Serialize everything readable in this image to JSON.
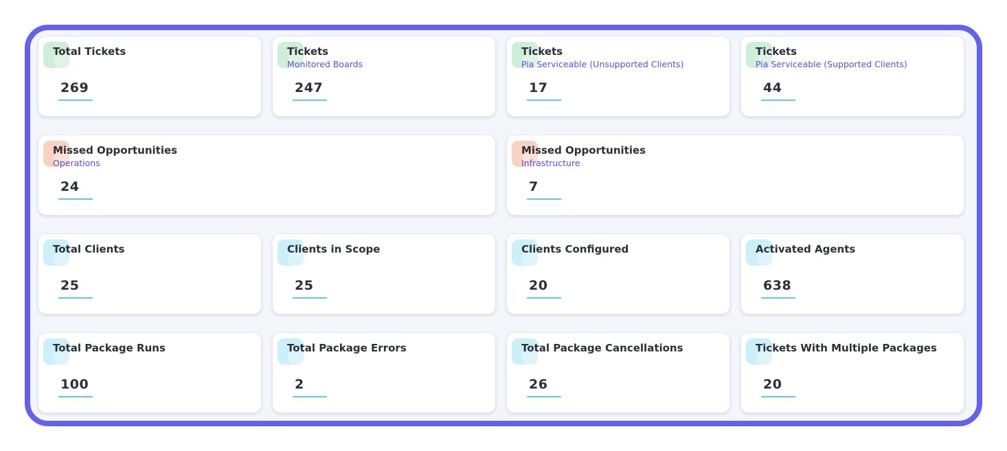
{
  "colors": {
    "frame_border": "#6361f0",
    "subtitle": "#5b4fe0",
    "underline": "#62c9ea",
    "icon_green": "#c6ead4",
    "icon_orange": "#f8cbb8",
    "icon_cyan": "#c4eef8"
  },
  "cards": [
    {
      "title": "Total Tickets",
      "subtitle": "",
      "value": "269",
      "icon": "ticket-icon",
      "icon_color": "green"
    },
    {
      "title": "Tickets",
      "subtitle": "Monitored Boards",
      "value": "247",
      "icon": "ticket-icon",
      "icon_color": "green"
    },
    {
      "title": "Tickets",
      "subtitle": "Pia Serviceable (Unsupported Clients)",
      "value": "17",
      "icon": "ticket-icon",
      "icon_color": "green"
    },
    {
      "title": "Tickets",
      "subtitle": "Pia Serviceable (Supported Clients)",
      "value": "44",
      "icon": "ticket-icon",
      "icon_color": "green"
    },
    {
      "title": "Missed Opportunities",
      "subtitle": "Operations",
      "value": "24",
      "icon": "alert-icon",
      "icon_color": "orange"
    },
    {
      "title": "Missed Opportunities",
      "subtitle": "Infrastructure",
      "value": "7",
      "icon": "alert-icon",
      "icon_color": "orange"
    },
    {
      "title": "Total Clients",
      "subtitle": "",
      "value": "25",
      "icon": "clients-icon",
      "icon_color": "cyan"
    },
    {
      "title": "Clients in Scope",
      "subtitle": "",
      "value": "25",
      "icon": "clients-icon",
      "icon_color": "cyan"
    },
    {
      "title": "Clients Configured",
      "subtitle": "",
      "value": "20",
      "icon": "clients-icon",
      "icon_color": "cyan"
    },
    {
      "title": "Activated Agents",
      "subtitle": "",
      "value": "638",
      "icon": "agent-icon",
      "icon_color": "cyan"
    },
    {
      "title": "Total Package Runs",
      "subtitle": "",
      "value": "100",
      "icon": "package-icon",
      "icon_color": "cyan"
    },
    {
      "title": "Total Package Errors",
      "subtitle": "",
      "value": "2",
      "icon": "package-icon",
      "icon_color": "cyan"
    },
    {
      "title": "Total Package Cancellations",
      "subtitle": "",
      "value": "26",
      "icon": "package-icon",
      "icon_color": "cyan"
    },
    {
      "title": "Tickets With Multiple Packages",
      "subtitle": "",
      "value": "20",
      "icon": "package-icon",
      "icon_color": "cyan"
    }
  ]
}
